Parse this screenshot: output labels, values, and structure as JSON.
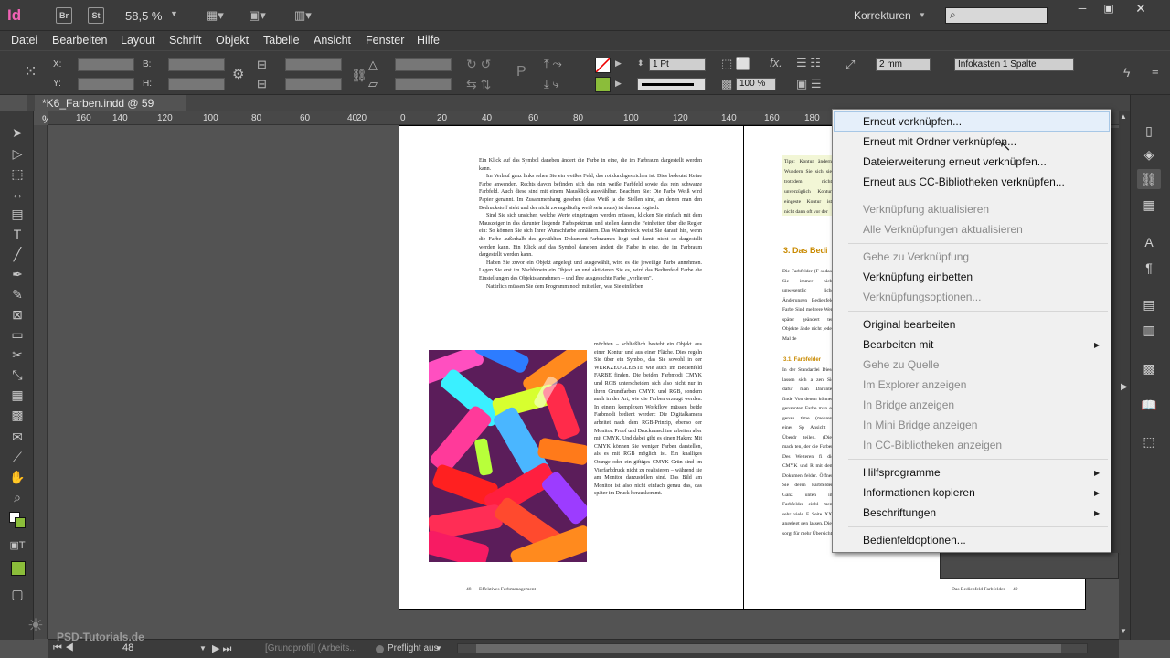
{
  "app": {
    "logo": "Id",
    "bridge_btn": "Br",
    "stock_btn": "St",
    "zoom_level": "58,5 %",
    "workspace": "Korrekturen",
    "search_placeholder": ""
  },
  "menubar": [
    "Datei",
    "Bearbeiten",
    "Layout",
    "Schrift",
    "Objekt",
    "Tabelle",
    "Ansicht",
    "Fenster",
    "Hilfe"
  ],
  "control": {
    "x_label": "X:",
    "y_label": "Y:",
    "b_label": "B:",
    "h_label": "H:",
    "stroke_weight": "1 Pt",
    "opacity": "100 %",
    "spacing": "2 mm",
    "object_style": "Infokasten 1 Spalte"
  },
  "document_tab": "*K6_Farben.indd @ 59 %",
  "ruler_ticks": [
    "160",
    "140",
    "120",
    "100",
    "80",
    "60",
    "40",
    "20",
    "0",
    "20",
    "40",
    "60",
    "80",
    "100",
    "120",
    "140",
    "160",
    "180",
    "200"
  ],
  "page_left": {
    "paragraphs": [
      "Ein Klick auf das Symbol daneben ändert die Farbe in eine, die im Farbraum dargestellt werden kann.",
      "Im Verlauf ganz links sehen Sie ein weißes Feld, das rot durchgestrichen ist. Dies bedeutet Keine Farbe anwenden. Rechts davon befinden sich das rein weiße Farbfeld sowie das rein schwarze Farbfeld. Auch diese sind mit einem Mausklick auswählbar. Beachten Sie: Die Farbe Weiß wird Papier genannt. Im Zusammenhang gesehen (dass Weiß ja die Stellen sind, an denen man den Bedruckstoff sieht und der nicht zwangsläufig weiß sein muss) ist das nur logisch.",
      "Sind Sie sich unsicher, welche Werte eingetragen werden müssen, klicken Sie einfach mit dem Mauszeiger in das darunter liegende Farbspektrum und stellen dann die Feinheiten über die Regler ein: So können Sie sich Ihrer Wunschfarbe annähern. Das Warndreieck weist Sie darauf hin, wenn die Farbe außerhalb des gewählten Dokument-Farbraumes liegt und damit nicht so dargestellt werden kann. Ein Klick auf das Symbol daneben ändert die Farbe in eine, die im Farbraum dargestellt werden kann.",
      "Haben Sie zuvor ein Objekt angelegt und ausgewählt, wird es die jeweilige Farbe annehmen. Legen Sie erst im Nachhinein ein Objekt an und aktivieren Sie es, wird das Bedienfeld Farbe die Einstellungen des Objekts annehmen – und Ihre ausgesuchte Farbe „verlieren\".",
      "Natürlich müssen Sie dem Programm noch mitteilen, was Sie einfärben"
    ],
    "side_text": "möchten – schließlich besteht ein Objekt aus einer Kontur und aus einer Fläche. Dies regeln Sie über ein Symbol, das Sie sowohl in der WERKZEUGLEISTE wie auch im Bedienfeld FARBE finden. Die beiden Farbmodi CMYK und RGB unterscheiden sich also nicht nur in ihren Grundfarben CMYK und RGB, sondern auch in der Art, wie die Farben erzeugt werden. In einem komplexen Workflow müssen beide Farbmodi bedient werden: Die Digitalkamera arbeitet nach dem RGB-Prinzip, ebenso der Monitor. Proof und Druckmaschine arbeiten aber mit CMYK. Und dabei gibt es einen Haken: Mit CMYK können Sie weniger Farben darstellen, als es mit RGB möglich ist. Ein knalliges Orange oder ein giftiges CMYK Grün sind im Vierfarbdruck nicht zu realisieren – während sie am Monitor darzustellen sind. Das Bild am Monitor ist also nicht einfach genau das, das später im Druck herauskommt.",
    "footer_num": "48",
    "footer_title": "Effektives Farbmanagement"
  },
  "page_right": {
    "tip": "Tipp: Kontur ändern Wundern Sie sich sie trotzdem nicht unverzüglich Kontur eingeste Kontur ist nicht dann oft vor der",
    "heading": "3. Das Bedi",
    "body": "Die Farbfelder (F sodass Sie immer nicht unwesentlic liche Änderungen Bedienfeld Farbe Sind mehrere Wert später geändert ten Objekte ände nicht jedes Mal de",
    "subheading": "3.1. Farbfelder",
    "body2": "In der Standardei Diese lassen sich a zen Sie dafür man Darunter finde Von denen können genannten Farbe man es genau time (mehrere eines Sp Ansicht - Überdr teilen. (Dies mach ten, der die Farben Des Weiteren fi die CMYK und R mit dem Dokumen felder. Öffnen Sie deren Farbfelder. Ganz unten im Farbfelder einbl ment sehr viele F Seite XX) angelegt gen lassen. Dies sorgt für mehr Übersicht",
    "footer_title": "Das Bedienfeld Farbfelder",
    "footer_num": "49"
  },
  "context_menu": [
    {
      "label": "Erneut verknüpfen...",
      "enabled": true,
      "hover": true
    },
    {
      "label": "Erneut mit Ordner verknüpfen...",
      "enabled": true
    },
    {
      "label": "Dateierweiterung erneut verknüpfen...",
      "enabled": true
    },
    {
      "label": "Erneut aus CC-Bibliotheken verknüpfen...",
      "enabled": true
    },
    {
      "label": "Verknüpfung aktualisieren",
      "enabled": false
    },
    {
      "label": "Alle Verknüpfungen aktualisieren",
      "enabled": false
    },
    {
      "label": "Gehe zu Verknüpfung",
      "enabled": false
    },
    {
      "label": "Verknüpfung einbetten",
      "enabled": true
    },
    {
      "label": "Verknüpfungsoptionen...",
      "enabled": false
    },
    {
      "label": "Original bearbeiten",
      "enabled": true
    },
    {
      "label": "Bearbeiten mit",
      "enabled": true,
      "submenu": true
    },
    {
      "label": "Gehe zu Quelle",
      "enabled": false
    },
    {
      "label": "Im Explorer anzeigen",
      "enabled": false
    },
    {
      "label": "In Bridge anzeigen",
      "enabled": false
    },
    {
      "label": "In Mini Bridge anzeigen",
      "enabled": false
    },
    {
      "label": "In CC-Bibliotheken anzeigen",
      "enabled": false
    },
    {
      "label": "Hilfsprogramme",
      "enabled": true,
      "submenu": true
    },
    {
      "label": "Informationen kopieren",
      "enabled": true,
      "submenu": true
    },
    {
      "label": "Beschriftungen",
      "enabled": true,
      "submenu": true
    },
    {
      "label": "Bedienfeldoptionen...",
      "enabled": true
    }
  ],
  "status": {
    "page": "48",
    "profile": "[Grundprofil] (Arbeits...",
    "preflight": "Preflight aus"
  },
  "watermark": "PSD-Tutorials.de",
  "colors": {
    "accent_logo": "#f062b4",
    "menu_hover": "#e5effa"
  }
}
